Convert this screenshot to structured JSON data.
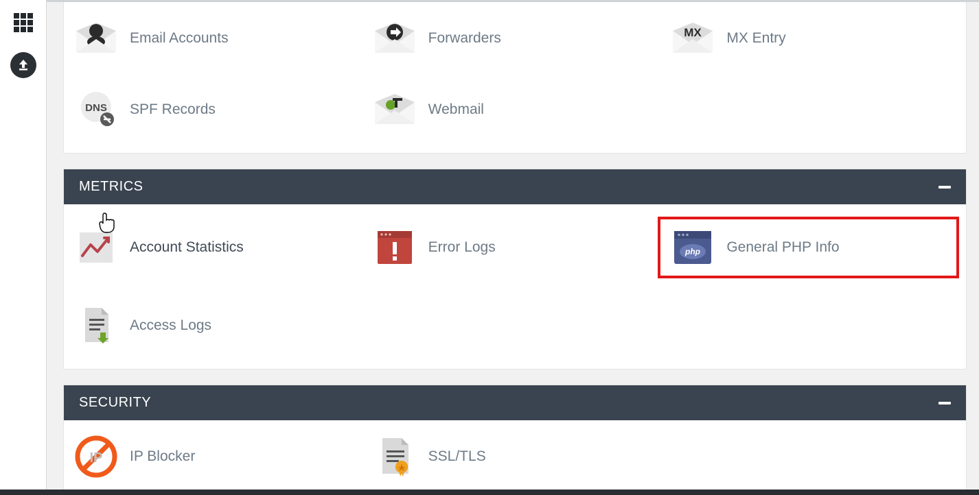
{
  "sidebar": {
    "apps_tooltip": "Applications",
    "upload_tooltip": "Upload"
  },
  "email_panel": {
    "items": [
      {
        "id": "email-accounts",
        "label": "Email Accounts"
      },
      {
        "id": "forwarders",
        "label": "Forwarders"
      },
      {
        "id": "mx-entry",
        "label": "MX Entry"
      },
      {
        "id": "spf-records",
        "label": "SPF Records"
      },
      {
        "id": "webmail",
        "label": "Webmail"
      }
    ]
  },
  "metrics_panel": {
    "title": "METRICS",
    "items": [
      {
        "id": "account-statistics",
        "label": "Account Statistics"
      },
      {
        "id": "error-logs",
        "label": "Error Logs"
      },
      {
        "id": "general-php-info",
        "label": "General PHP Info",
        "highlighted": true
      },
      {
        "id": "access-logs",
        "label": "Access Logs"
      }
    ]
  },
  "security_panel": {
    "title": "SECURITY",
    "items": [
      {
        "id": "ip-blocker",
        "label": "IP Blocker"
      },
      {
        "id": "ssl-tls",
        "label": "SSL/TLS"
      }
    ]
  }
}
